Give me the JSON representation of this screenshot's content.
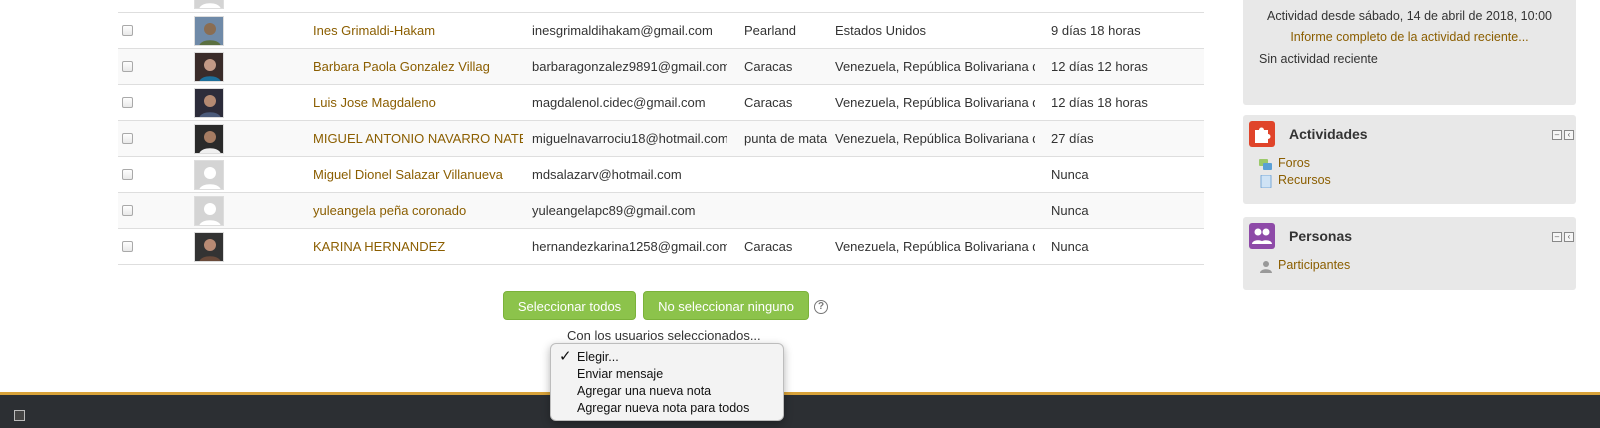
{
  "participants": [
    {
      "name": "",
      "email": "",
      "city": "",
      "country": "",
      "last_access": "",
      "avatar": "default"
    },
    {
      "name": "Ines Grimaldi-Hakam",
      "email": "inesgrimaldihakam@gmail.com",
      "city": "Pearland",
      "country": "Estados Unidos",
      "last_access": "9 días 18 horas",
      "avatar": "photo"
    },
    {
      "name": "Barbara Paola Gonzalez Villag",
      "email": "barbaragonzalez9891@gmail.com",
      "city": "Caracas",
      "country": "Venezuela, República Bolivariana de",
      "last_access": "12 días 12 horas",
      "avatar": "photo"
    },
    {
      "name": "Luis Jose Magdaleno",
      "email": "magdalenol.cidec@gmail.com",
      "city": "Caracas",
      "country": "Venezuela, República Bolivariana de",
      "last_access": "12 días 18 horas",
      "avatar": "photo"
    },
    {
      "name": "MIGUEL ANTONIO NAVARRO NATERA",
      "email": "miguelnavarrociu18@hotmail.com",
      "city": "punta de mata",
      "country": "Venezuela, República Bolivariana de",
      "last_access": "27 días",
      "avatar": "photo"
    },
    {
      "name": "Miguel Dionel Salazar Villanueva",
      "email": "mdsalazarv@hotmail.com",
      "city": "",
      "country": "",
      "last_access": "Nunca",
      "avatar": "default"
    },
    {
      "name": "yuleangela peña coronado",
      "email": "yuleangelapc89@gmail.com",
      "city": "",
      "country": "",
      "last_access": "Nunca",
      "avatar": "default"
    },
    {
      "name": "KARINA HERNANDEZ",
      "email": "hernandezkarina1258@gmail.com",
      "city": "Caracas",
      "country": "Venezuela, República Bolivariana de",
      "last_access": "Nunca",
      "avatar": "photo"
    }
  ],
  "actions": {
    "select_all": "Seleccionar todos",
    "select_none": "No seleccionar ninguno",
    "help": "?",
    "with_selected": "Con los usuarios seleccionados...",
    "dropdown_options": [
      "Elegir...",
      "Enviar mensaje",
      "Agregar una nueva nota",
      "Agregar nueva nota para todos"
    ],
    "selected_option": "Elegir...",
    "check_mark": "✓"
  },
  "sidebar": {
    "recent": {
      "since": "Actividad desde sábado, 14 de abril de 2018, 10:00",
      "report_link": "Informe completo de la actividad reciente...",
      "none": "Sin actividad reciente"
    },
    "activities": {
      "title": "Actividades",
      "icon": "puzzle-icon",
      "color": "#e0442a",
      "items": [
        "Foros",
        "Recursos"
      ]
    },
    "people": {
      "title": "Personas",
      "icon": "people-icon",
      "color": "#8e4aa8",
      "items": [
        "Participantes"
      ]
    }
  },
  "colors": {
    "link": "#8b5e00",
    "button": "#8cc34b",
    "footer": "#2c2f33",
    "footer_accent": "#d8a23a"
  }
}
